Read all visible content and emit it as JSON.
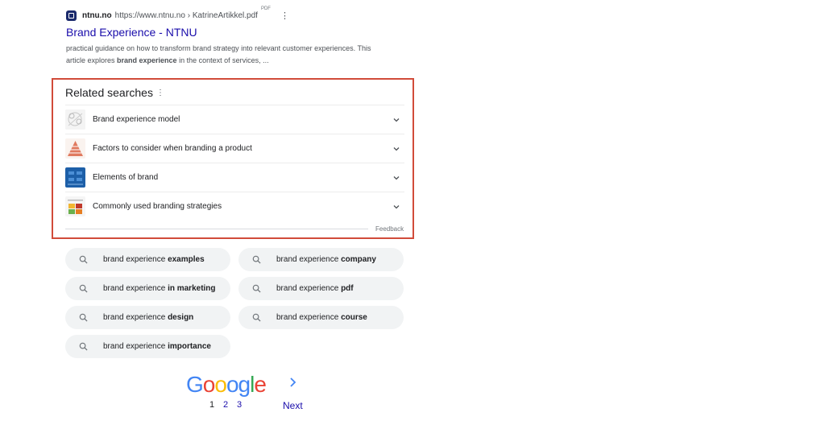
{
  "result": {
    "site_name": "ntnu.no",
    "url": "https://www.ntnu.no › KatrineArtikkel.pdf",
    "file_type": "PDF",
    "title": "Brand Experience - NTNU",
    "snippet_line1": "practical guidance on how to transform brand strategy into relevant customer experiences. This",
    "snippet_line2_pre": "article explores ",
    "snippet_line2_bold": "brand experience",
    "snippet_line2_post": " in the context of services, ..."
  },
  "related": {
    "heading": "Related searches",
    "items": [
      {
        "label": "Brand experience model",
        "thumb": "diagram"
      },
      {
        "label": "Factors to consider when branding a product",
        "thumb": "pyramid"
      },
      {
        "label": "Elements of brand",
        "thumb": "blue-chart"
      },
      {
        "label": "Commonly used branding strategies",
        "thumb": "matrix"
      }
    ],
    "feedback": "Feedback"
  },
  "chips": [
    {
      "prefix": "brand experience ",
      "bold": "examples"
    },
    {
      "prefix": "brand experience ",
      "bold": "company"
    },
    {
      "prefix": "brand experience ",
      "bold": "in marketing"
    },
    {
      "prefix": "brand experience ",
      "bold": "pdf"
    },
    {
      "prefix": "brand experience ",
      "bold": "design"
    },
    {
      "prefix": "brand experience ",
      "bold": "course"
    },
    {
      "prefix": "brand experience ",
      "bold": "importance"
    }
  ],
  "pagination": {
    "logo_letters": [
      "G",
      "o",
      "o",
      "o",
      "g",
      "l",
      "e"
    ],
    "logo_colors": [
      "#4285f4",
      "#ea4335",
      "#fbbc05",
      "#4285f4",
      "#4285f4",
      "#34a853",
      "#ea4335"
    ],
    "pages": [
      "1",
      "2",
      "3"
    ],
    "current_page": "1",
    "next_label": "Next"
  },
  "colors": {
    "link": "#1a0dab",
    "highlight_frame": "#d14b3a",
    "chip_bg": "#f1f3f4"
  }
}
